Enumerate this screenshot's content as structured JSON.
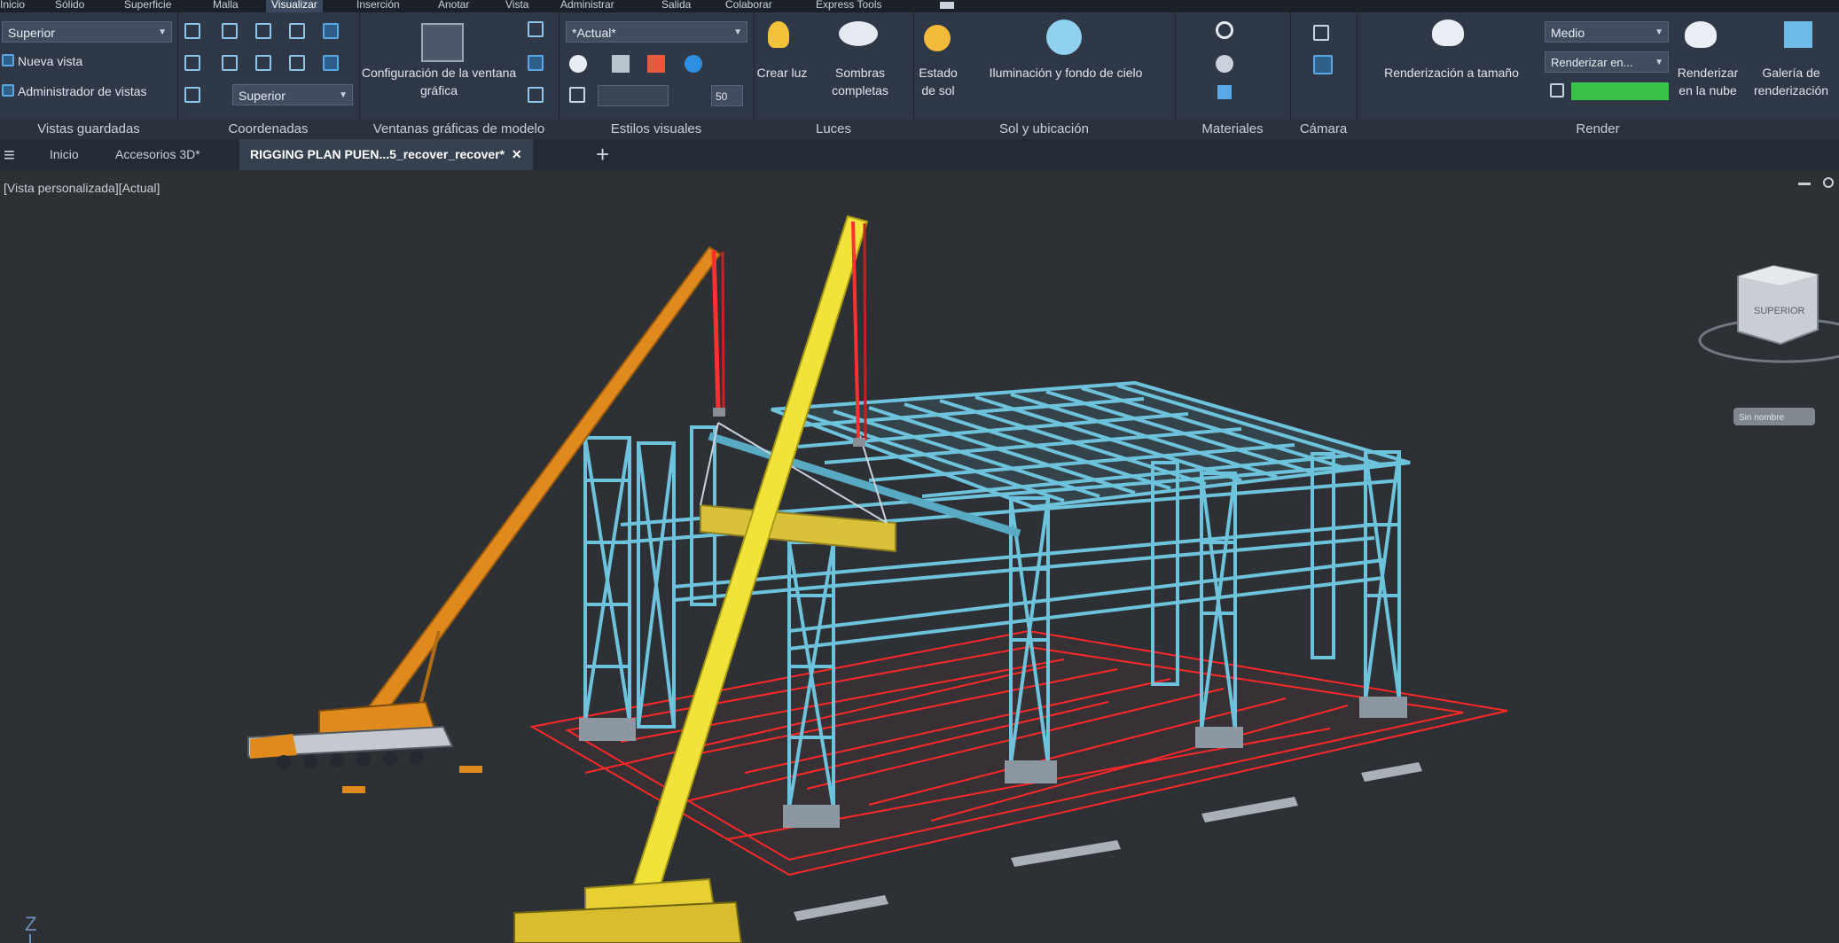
{
  "menubar": {
    "tabs": [
      "Inicio",
      "Sólido",
      "Superficie",
      "Malla",
      "Visualizar",
      "Inserción",
      "Anotar",
      "Vista",
      "Administrar",
      "Salida",
      "Colaborar",
      "Express Tools"
    ],
    "active_index": 4
  },
  "ribbon": {
    "vistas_guardadas": {
      "title": "Vistas guardadas",
      "view_combo": "Superior",
      "new_view": "Nueva vista",
      "view_manager": "Administrador de vistas"
    },
    "coordenadas": {
      "title": "Coordenadas",
      "ucs_combo": "Superior"
    },
    "ventanas": {
      "title": "Ventanas gráficas de modelo",
      "config_label": "Configuración de la ventana gráfica"
    },
    "estilos": {
      "title": "Estilos visuales",
      "style_combo": "*Actual*",
      "value": "50"
    },
    "luces": {
      "title": "Luces",
      "create_light": "Crear luz",
      "full_shadows": "Sombras completas"
    },
    "sol": {
      "title": "Sol y ubicación",
      "sun_status": "Estado de sol",
      "sky": "Iluminación y fondo de cielo"
    },
    "materiales": {
      "title": "Materiales"
    },
    "camara": {
      "title": "Cámara"
    },
    "render": {
      "title": "Render",
      "render_size": "Renderización a tamaño",
      "quality_combo": "Medio",
      "render_in_combo": "Renderizar en...",
      "cloud": "Renderizar en la nube",
      "gallery": "Galería de renderización"
    }
  },
  "doctabs": {
    "tabs": [
      "Inicio",
      "Accesorios 3D*",
      "RIGGING PLAN PUEN...5_recover_recover*"
    ],
    "active_index": 2,
    "new_tab": "+",
    "close": "✕"
  },
  "viewport": {
    "label": "[Vista personalizada][Actual]",
    "viewcube_label": "SUPERIOR",
    "wcs_label": "Sin nombre",
    "axis_label": "Z"
  },
  "colors": {
    "frame": "#6ec3dc",
    "crane_orange": "#e08a1e",
    "crane_yellow": "#f2e33a",
    "foundation": "#ff2828",
    "background": "#2d3135",
    "progress": "#37c24a"
  }
}
